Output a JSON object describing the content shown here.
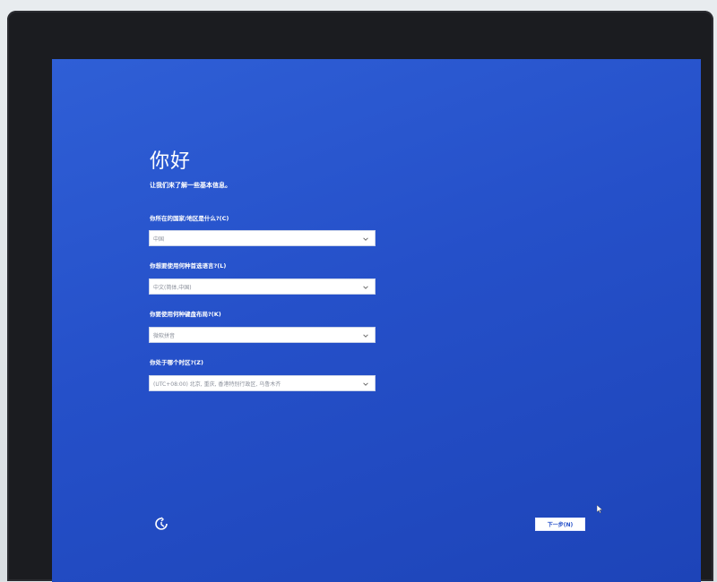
{
  "setup": {
    "title": "你好",
    "subtitle": "让我们来了解一些基本信息。",
    "fields": [
      {
        "label": "你所在的国家/地区是什么?(C)",
        "value": "中国"
      },
      {
        "label": "你想要使用何种首选语言?(L)",
        "value": "中文(简体,中国)"
      },
      {
        "label": "你要使用何种键盘布局?(K)",
        "value": "微软拼音"
      },
      {
        "label": "你处于哪个时区?(Z)",
        "value": "(UTC+08:00) 北京, 重庆, 香港特别行政区, 乌鲁木齐"
      }
    ],
    "next_label": "下一步(N)"
  },
  "icons": {
    "ease_of_access": "ease-of-access-icon",
    "dropdown": "chevron-down-icon",
    "cursor": "mouse-cursor-icon"
  },
  "colors": {
    "screen_blue": "#2550c9",
    "text": "#ffffff",
    "field_bg": "#ffffff"
  }
}
